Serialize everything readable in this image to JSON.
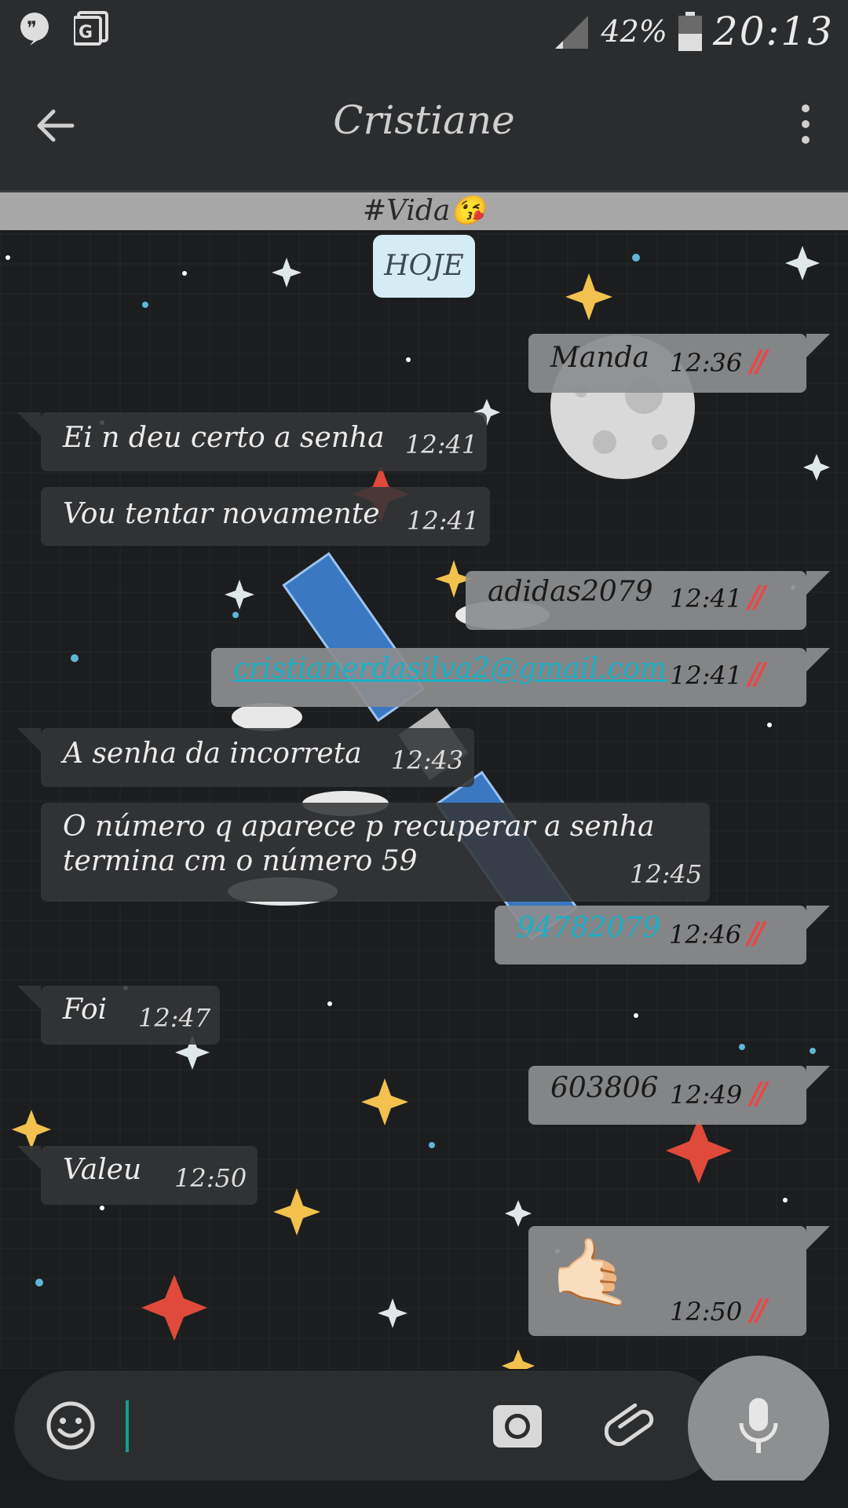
{
  "status_bar": {
    "battery": "42%",
    "time": "20:13",
    "icons": [
      "quote-icon",
      "google-plus-icon",
      "signal-icon",
      "battery-icon"
    ]
  },
  "app_bar": {
    "title": "Cristiane",
    "status": "#Vida😘",
    "icons": [
      "back-arrow-icon",
      "more-vert-icon"
    ]
  },
  "chat": {
    "date_label": "HOJE",
    "messages": [
      {
        "dir": "out",
        "text": "Manda",
        "time": "12:36",
        "ticks": "//"
      },
      {
        "dir": "in",
        "text": "Ei n deu certo a senha",
        "time": "12:41"
      },
      {
        "dir": "in",
        "text": "Vou tentar novamente",
        "time": "12:41"
      },
      {
        "dir": "out",
        "text": "adidas2079",
        "time": "12:41",
        "ticks": "//"
      },
      {
        "dir": "out",
        "text": "cristianerdasilva2@gmail.com",
        "time": "12:41",
        "ticks": "//"
      },
      {
        "dir": "in",
        "text": "A senha da incorreta",
        "time": "12:43"
      },
      {
        "dir": "in",
        "text_line1": "O número q aparece p recuperar a senha",
        "text_line2": "termina cm o número 59",
        "time": "12:45"
      },
      {
        "dir": "out",
        "text": "94782079",
        "time": "12:46",
        "ticks": "//"
      },
      {
        "dir": "in",
        "text": "Foi",
        "time": "12:47"
      },
      {
        "dir": "out",
        "text": "603806",
        "time": "12:49",
        "ticks": "//"
      },
      {
        "dir": "in",
        "text": "Valeu",
        "time": "12:50"
      },
      {
        "dir": "out",
        "emoji": "🤙🏻",
        "time": "12:50",
        "ticks": "//"
      }
    ]
  },
  "input_bar": {
    "icons": [
      "emoji-icon",
      "camera-icon",
      "attach-icon",
      "mic-icon"
    ]
  },
  "colors": {
    "bar_bg": "#2b2c2e",
    "status_strip": "#a7a7a7",
    "incoming_bubble": "#343538",
    "outgoing_bubble": "#8c8d8f",
    "tick_red": "#e84848",
    "link_blue": "#1ab0c6",
    "caret_teal": "#10a090"
  }
}
